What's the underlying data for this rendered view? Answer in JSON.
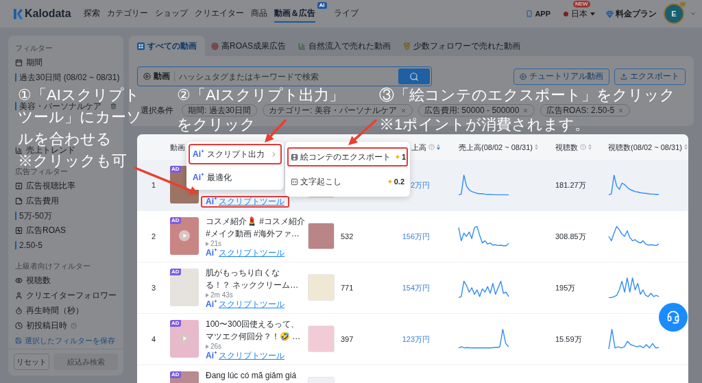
{
  "nav": {
    "logo": "Kalodata",
    "items": [
      {
        "label": "探索",
        "selected": false
      },
      {
        "label": "カテゴリー",
        "selected": false
      },
      {
        "label": "ショップ",
        "selected": false
      },
      {
        "label": "クリエイター",
        "selected": false
      },
      {
        "label": "商品",
        "selected": false
      },
      {
        "label": "動画＆広告",
        "selected": true,
        "badge": "AI"
      },
      {
        "label": "ライブ",
        "selected": false
      }
    ],
    "app": "APP",
    "region": "日本",
    "region_badge": "NEW",
    "pricing": "料金プラン",
    "avatar": "E"
  },
  "sidebar": {
    "sections": [
      {
        "title": "フィルター",
        "filters": [
          {
            "label": "期間",
            "value": "過去30日間 (08/02 ~ 08/31)"
          },
          {
            "value": "美容・パーソナルケア",
            "removable": true
          }
        ]
      },
      {
        "filters": [
          {
            "label": "売上トレンド"
          }
        ]
      },
      {
        "title": "広告フィルター",
        "filters": [
          {
            "label": "広告視聴比率"
          },
          {
            "label": "広告費用",
            "value": "5万-50万"
          },
          {
            "label": "広告ROAS",
            "value": "2.50-5"
          }
        ]
      },
      {
        "title": "上級者向けフィルター",
        "filters": [
          {
            "label": "視聴数"
          },
          {
            "label": "クリエイターフォロワー"
          },
          {
            "label": "再生時間（秒）"
          },
          {
            "label": "初投稿日時",
            "help": true
          }
        ]
      }
    ],
    "save_link": "選択したフィルターを保存",
    "buttons": [
      {
        "label": "リセット",
        "disabled": false
      },
      {
        "label": "絞込み検索",
        "disabled": true
      }
    ]
  },
  "tabs": [
    {
      "label": "すべての動画",
      "selected": true
    },
    {
      "label": "高ROAS成果広告",
      "selected": false
    },
    {
      "label": "自然流入で売れた動画",
      "selected": false
    },
    {
      "label": "少数フォロワーで売れた動画",
      "selected": false
    }
  ],
  "search": {
    "scope": "動画",
    "placeholder": "ハッシュタグまたはキーワードで検索"
  },
  "actions": [
    "チュートリアル動画",
    "エクスポート"
  ],
  "conditions": {
    "label": "選択条件",
    "chips": [
      {
        "text": "期間: 過去30日間",
        "removable": false
      },
      {
        "text": "カテゴリー: 美容・パーソナルケア",
        "removable": true
      },
      {
        "text": "広告費用: 50000 - 500000",
        "removable": true
      },
      {
        "text": "広告ROAS: 2.50-5",
        "removable": true
      }
    ]
  },
  "table": {
    "columns": [
      {
        "label": "動画"
      },
      {
        "label": "上高",
        "help": true,
        "sorted": true
      },
      {
        "label": "売上高(08/02 ~ 08/31)",
        "sorted": false
      },
      {
        "label": "視聴数",
        "help": true,
        "sorted": false
      },
      {
        "label": "視聴数(08/02 ~ 08/31)",
        "sorted": false
      }
    ],
    "rows": [
      {
        "index": "1",
        "hovered": true,
        "ad": "AD",
        "play_button": false,
        "link": {
          "mark": "Ai",
          "label": "スクリプトツール",
          "highlighted": true
        },
        "sales": "2万円",
        "views": "181.27万"
      },
      {
        "index": "2",
        "hovered": false,
        "ad": "AD",
        "play_button": true,
        "title": [
          "コスメ紹介💄 #コスメ紹介",
          "#メイク動画 #海外ファ…"
        ],
        "duration": "21s",
        "link": {
          "mark": "Ai",
          "label": "スクリプトツール",
          "highlighted": false
        },
        "count": "532",
        "sales": "156万円",
        "views": "308.85万"
      },
      {
        "index": "3",
        "hovered": false,
        "ad": "AD",
        "play_button": false,
        "title": [
          "肌がもっちり白くな",
          "る！？ ネッククリーム…"
        ],
        "duration": "2m 43s",
        "link": {
          "mark": "Ai",
          "label": "スクリプトツール",
          "highlighted": false
        },
        "count": "771",
        "sales": "154万円",
        "views": "195万"
      },
      {
        "index": "4",
        "hovered": false,
        "ad": "AD",
        "play_button": true,
        "title": [
          "100〜300回使えるって、",
          "マツエク何回分？！🤣 …"
        ],
        "duration": "26s",
        "link": {
          "mark": "Ai",
          "label": "スクリプトツール",
          "highlighted": false
        },
        "count": "397",
        "sales": "123万円",
        "views": "15.59万"
      },
      {
        "hovered": false,
        "ad": "AD",
        "play_button": false,
        "title": [
          "Đang lúc có mã giảm giá"
        ]
      }
    ]
  },
  "menu": {
    "items": [
      {
        "mark": "Ai",
        "label": "スクリプト出力",
        "has_submenu": true,
        "highlighted": true
      },
      {
        "mark": "Ai",
        "label": "最適化",
        "has_submenu": false,
        "highlighted": false
      }
    ]
  },
  "submenu": {
    "items": [
      {
        "label": "絵コンテのエクスポート",
        "cost": "1",
        "highlighted": true
      },
      {
        "label": "文字起こし",
        "cost": "0.2",
        "highlighted": false
      }
    ]
  },
  "annotations": [
    {
      "lines": [
        "①「AIスクリプト",
        "ツール」にカーソ",
        "ルを合わせる"
      ],
      "note": "※クリックも可"
    },
    {
      "lines": [
        "②「AIスクリプト出力」",
        "をクリック"
      ]
    },
    {
      "lines": [
        "③「絵コンテのエクスポート」をクリック"
      ],
      "note": "※1ポイントが消費されます。"
    }
  ]
}
